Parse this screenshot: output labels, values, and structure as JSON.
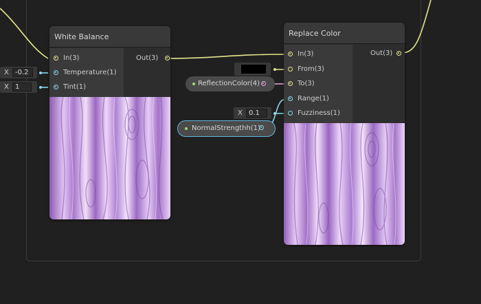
{
  "colors": {
    "vector3_port": "#e4e68a",
    "float_port": "#8ad8e8",
    "color_port": "#e8a8e0",
    "selected_outline": "#5eb8e0",
    "swatch_color": "#000000"
  },
  "nodes": {
    "white_balance": {
      "title": "White Balance",
      "inputs": [
        "In(3)",
        "Temperature(1)",
        "Tint(1)"
      ],
      "outputs": [
        "Out(3)"
      ]
    },
    "replace_color": {
      "title": "Replace Color",
      "inputs": [
        "In(3)",
        "From(3)",
        "To(3)",
        "Range(1)",
        "Fuzziness(1)"
      ],
      "outputs": [
        "Out(3)"
      ]
    }
  },
  "fields": {
    "temperature": {
      "axis": "X",
      "value": "-0.2"
    },
    "tint": {
      "axis": "X",
      "value": "1"
    },
    "fuzziness": {
      "axis": "X",
      "value": "0.1"
    }
  },
  "properties": {
    "reflection_color": "ReflectionColor(4)",
    "normal_strength": "NormalStrengthh(1)"
  }
}
